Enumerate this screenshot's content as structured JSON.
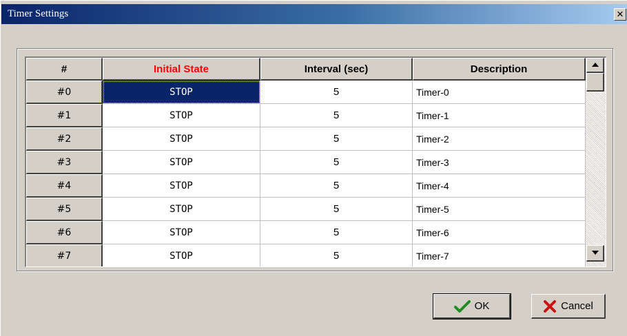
{
  "window": {
    "title": "Timer Settings",
    "close_glyph": "✕"
  },
  "grid": {
    "columns": [
      "#",
      "Initial State",
      "Interval (sec)",
      "Description"
    ],
    "header_colors": {
      "initial_state": "#ff0000"
    },
    "rows": [
      {
        "index": "#0",
        "state": "STOP",
        "interval": "5",
        "description": "Timer-0"
      },
      {
        "index": "#1",
        "state": "STOP",
        "interval": "5",
        "description": "Timer-1"
      },
      {
        "index": "#2",
        "state": "STOP",
        "interval": "5",
        "description": "Timer-2"
      },
      {
        "index": "#3",
        "state": "STOP",
        "interval": "5",
        "description": "Timer-3"
      },
      {
        "index": "#4",
        "state": "STOP",
        "interval": "5",
        "description": "Timer-4"
      },
      {
        "index": "#5",
        "state": "STOP",
        "interval": "5",
        "description": "Timer-5"
      },
      {
        "index": "#6",
        "state": "STOP",
        "interval": "5",
        "description": "Timer-6"
      },
      {
        "index": "#7",
        "state": "STOP",
        "interval": "5",
        "description": "Timer-7"
      }
    ],
    "selected_row": 0,
    "selection_color": "#0a246a"
  },
  "buttons": {
    "ok_label": "OK",
    "cancel_label": "Cancel",
    "ok_icon": "checkmark-icon",
    "cancel_icon": "x-icon",
    "ok_icon_color": "#228b22",
    "cancel_icon_color": "#cc1111"
  }
}
